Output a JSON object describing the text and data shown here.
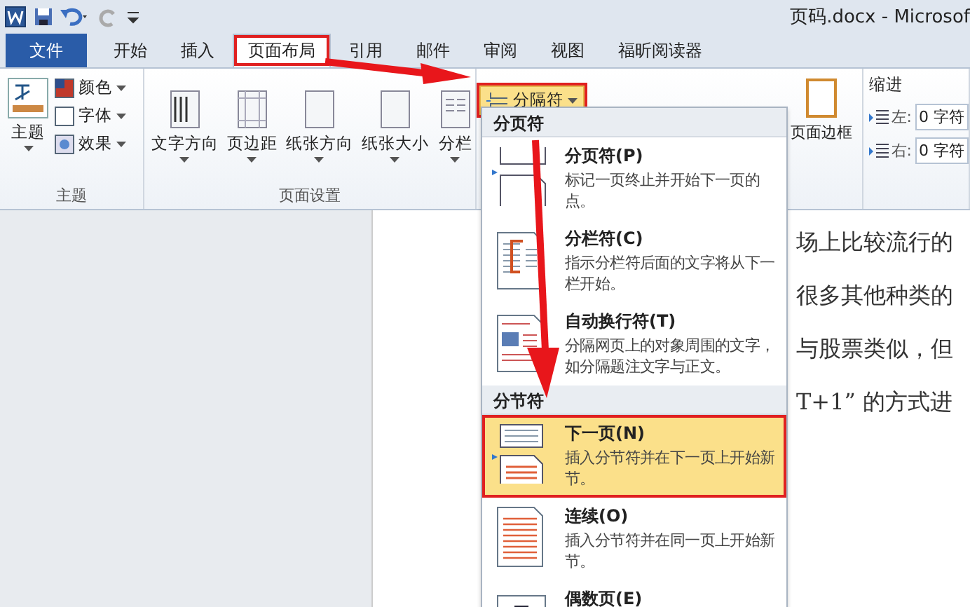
{
  "window": {
    "title": "页码.docx - Microsof"
  },
  "tabs": [
    {
      "label": "文件",
      "kind": "file",
      "selected": false,
      "annotated": false
    },
    {
      "label": "开始",
      "kind": "tab",
      "selected": false,
      "annotated": false
    },
    {
      "label": "插入",
      "kind": "tab",
      "selected": false,
      "annotated": false
    },
    {
      "label": "页面布局",
      "kind": "tab",
      "selected": true,
      "annotated": true
    },
    {
      "label": "引用",
      "kind": "tab",
      "selected": false,
      "annotated": false
    },
    {
      "label": "邮件",
      "kind": "tab",
      "selected": false,
      "annotated": false
    },
    {
      "label": "审阅",
      "kind": "tab",
      "selected": false,
      "annotated": false
    },
    {
      "label": "视图",
      "kind": "tab",
      "selected": false,
      "annotated": false
    },
    {
      "label": "福昕阅读器",
      "kind": "tab",
      "selected": false,
      "annotated": false
    }
  ],
  "ribbon": {
    "theme_group": {
      "label": "主题",
      "big_button": "主题",
      "small_buttons": [
        "颜色",
        "字体",
        "效果"
      ]
    },
    "page_setup_group": {
      "label": "页面设置",
      "buttons": [
        "文字方向",
        "页边距",
        "纸张方向",
        "纸张大小",
        "分栏"
      ],
      "breaks_button": {
        "label": "分隔符",
        "annotated": true
      }
    },
    "page_borders_button": "页面边框",
    "indent_group": {
      "label": "缩进",
      "fields": [
        {
          "label": "左:",
          "value": "0 字符"
        },
        {
          "label": "右:",
          "value": "0 字符"
        }
      ]
    }
  },
  "breaks_menu": {
    "sections": [
      {
        "header": "分页符",
        "items": [
          {
            "kind": "page",
            "title": "分页符(P)",
            "description": "标记一页终止并开始下一页的点。",
            "selected": false,
            "annotated": false
          },
          {
            "kind": "column",
            "title": "分栏符(C)",
            "description": "指示分栏符后面的文字将从下一栏开始。",
            "selected": false,
            "annotated": false
          },
          {
            "kind": "wrap",
            "title": "自动换行符(T)",
            "description": "分隔网页上的对象周围的文字，如分隔题注文字与正文。",
            "selected": false,
            "annotated": false
          }
        ]
      },
      {
        "header": "分节符",
        "items": [
          {
            "kind": "next",
            "title": "下一页(N)",
            "description": "插入分节符并在下一页上开始新节。",
            "selected": true,
            "annotated": true
          },
          {
            "kind": "continuous",
            "title": "连续(O)",
            "description": "插入分节符并在同一页上开始新节。",
            "selected": false,
            "annotated": false
          },
          {
            "kind": "even",
            "title": "偶数页(E)",
            "selected": false,
            "annotated": false
          }
        ]
      }
    ]
  },
  "document": {
    "lines": [
      "场上比较流行的",
      "很多其他种类的",
      "与股票类似，但",
      "T+1” 的方式进"
    ]
  }
}
